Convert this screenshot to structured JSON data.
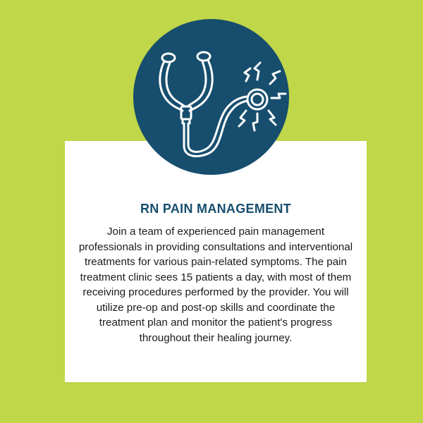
{
  "background_color": "#bfd748",
  "accent_color": "#174e6e",
  "icon": "stethoscope-icon",
  "title": "RN PAIN MANAGEMENT",
  "description": "Join a team of experienced pain management professionals in providing consultations and interventional treatments for various pain-related symptoms. The pain treatment clinic sees 15 patients a day, with most of them receiving procedures performed by the provider. You will utilize pre-op and post-op skills and coordinate the treatment plan and monitor the patient's progress throughout their healing journey."
}
